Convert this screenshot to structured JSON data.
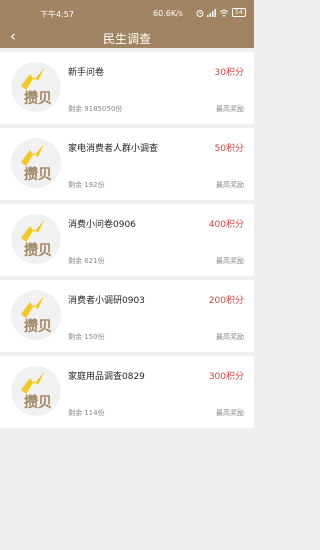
{
  "status": {
    "time": "下午4:57",
    "net": "60.6K/s",
    "battery": "54"
  },
  "nav": {
    "back_glyph": "‹",
    "title": "民生调查"
  },
  "logo_text": "攒贝",
  "items": [
    {
      "name": "新手问卷",
      "points": "30积分",
      "remain": "剩余 9185050份",
      "reward": "最高奖励"
    },
    {
      "name": "家电消费者人群小调查",
      "points": "50积分",
      "remain": "剩余 192份",
      "reward": "最高奖励"
    },
    {
      "name": "消费小问卷0906",
      "points": "400积分",
      "remain": "剩余 621份",
      "reward": "最高奖励"
    },
    {
      "name": "消费者小调研0903",
      "points": "200积分",
      "remain": "剩余 150份",
      "reward": "最高奖励"
    },
    {
      "name": "家庭用品调查0829",
      "points": "300积分",
      "remain": "剩余 114份",
      "reward": "最高奖励"
    }
  ],
  "colors": {
    "brand": "#a18563",
    "points": "#d0453c",
    "lightning": "#f2c81e"
  }
}
